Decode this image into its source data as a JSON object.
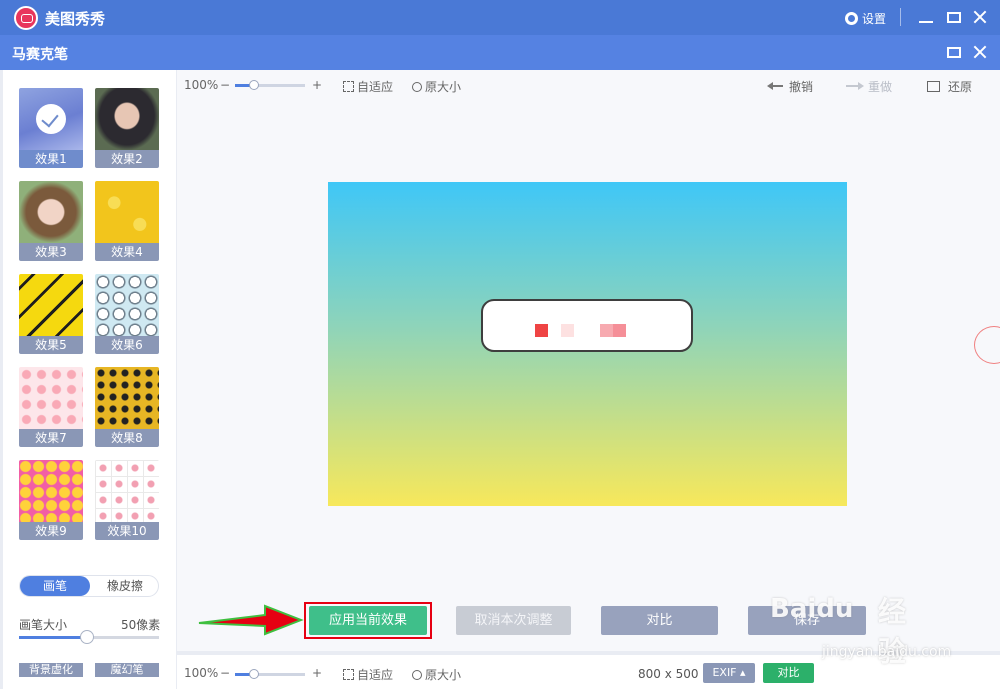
{
  "app": {
    "name": "美图秀秀",
    "settings_label": "设置"
  },
  "panel": {
    "title": "马赛克笔"
  },
  "effects": [
    {
      "label": "效果1",
      "selected": true
    },
    {
      "label": "效果2"
    },
    {
      "label": "效果3"
    },
    {
      "label": "效果4"
    },
    {
      "label": "效果5"
    },
    {
      "label": "效果6"
    },
    {
      "label": "效果7"
    },
    {
      "label": "效果8"
    },
    {
      "label": "效果9"
    },
    {
      "label": "效果10"
    }
  ],
  "tools": {
    "brush": "画笔",
    "eraser": "橡皮擦",
    "active": "画笔"
  },
  "brush_size": {
    "label": "画笔大小",
    "value": "50像素",
    "level_percent": 50
  },
  "sidebar_bottom": {
    "bg_blur": "背景虚化",
    "magic_pen": "魔幻笔"
  },
  "toolbar": {
    "zoom": "100%",
    "minus": "−",
    "plus": "+",
    "fit": "自适应",
    "original_size": "原大小",
    "undo": "撤销",
    "redo": "重做",
    "restore": "还原"
  },
  "actions": {
    "apply": "应用当前效果",
    "cancel": "取消本次调整",
    "compare": "对比",
    "save": "保存"
  },
  "status": {
    "zoom": "100%",
    "dimensions": "800 x 500",
    "exif": "EXIF ▴",
    "compare": "对比"
  },
  "colors": {
    "titlebar": "#4a79d6",
    "subbar": "#5582e2",
    "apply_button": "#3fbf8a",
    "highlight_frame": "#e60012",
    "arrow": "#e60012"
  },
  "watermark": {
    "logo": "Baidu",
    "cn": "经验",
    "url": "jingyan.baidu.com"
  }
}
